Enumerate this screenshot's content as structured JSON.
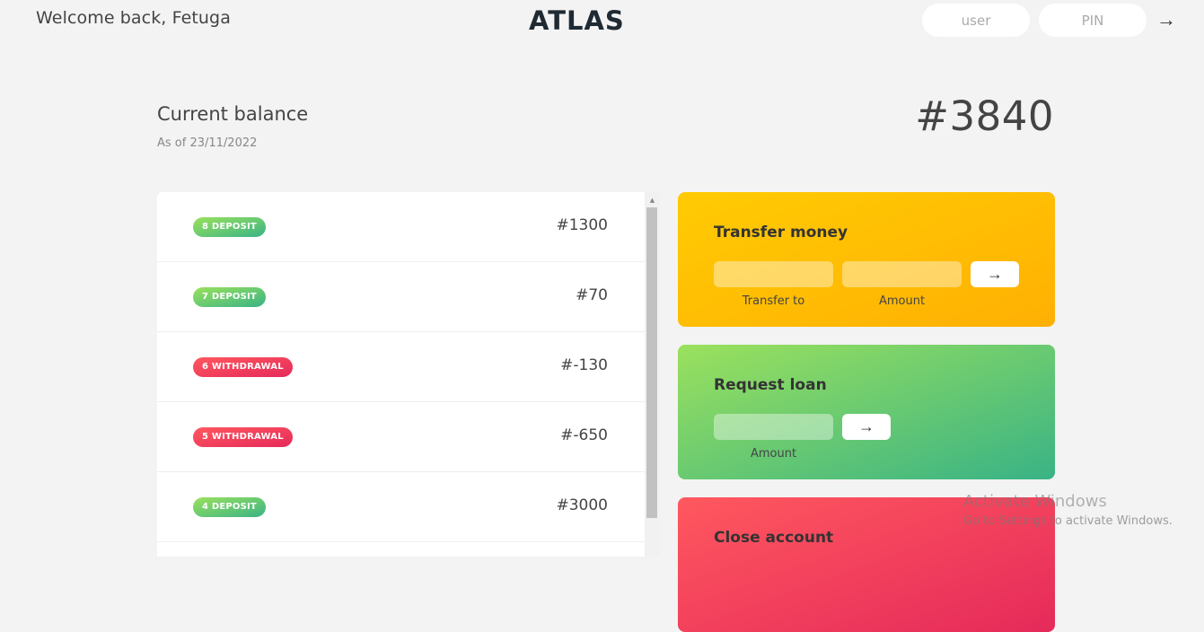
{
  "nav": {
    "welcome": "Welcome back, Fetuga",
    "logo": "ATLAS",
    "user_placeholder": "user",
    "pin_placeholder": "PIN",
    "login_arrow": "→"
  },
  "balance": {
    "label": "Current balance",
    "date": "As of 23/11/2022",
    "value": "#3840"
  },
  "movements": [
    {
      "type": "8 DEPOSIT",
      "kind": "deposit",
      "value": "#1300"
    },
    {
      "type": "7 DEPOSIT",
      "kind": "deposit",
      "value": "#70"
    },
    {
      "type": "6 WITHDRAWAL",
      "kind": "withdrawal",
      "value": "#-130"
    },
    {
      "type": "5 WITHDRAWAL",
      "kind": "withdrawal",
      "value": "#-650"
    },
    {
      "type": "4 DEPOSIT",
      "kind": "deposit",
      "value": "#3000"
    },
    {
      "type": "",
      "kind": "deposit",
      "value": ""
    }
  ],
  "operations": {
    "transfer": {
      "title": "Transfer money",
      "to_label": "Transfer to",
      "amount_label": "Amount",
      "button": "→"
    },
    "loan": {
      "title": "Request loan",
      "amount_label": "Amount",
      "button": "→"
    },
    "close": {
      "title": "Close account"
    }
  },
  "watermark": {
    "title": "Activate Windows",
    "subtitle": "Go to Settings to activate Windows."
  },
  "colors": {
    "background": "#f3f3f3",
    "deposit": "#39b385",
    "withdrawal": "#e52a5a",
    "transfer": "#ffb003",
    "loan": "#9be15d",
    "close": "#ff585f"
  }
}
